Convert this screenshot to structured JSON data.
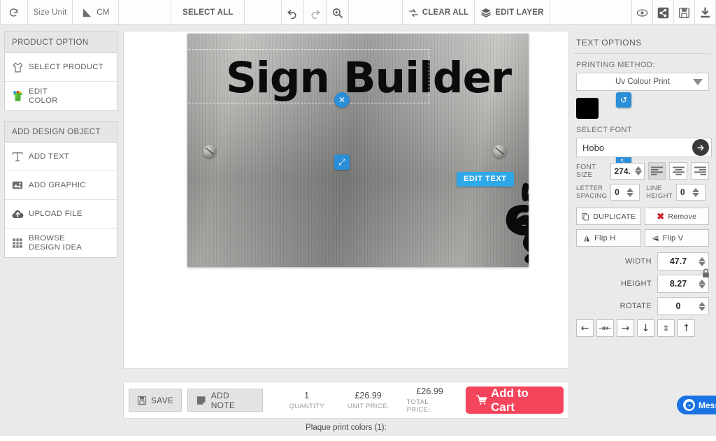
{
  "toolbar": {
    "refresh_icon": "refresh-icon",
    "size_unit_label": "Size Unit",
    "unit_value": "CM",
    "ruler_icon": "ruler-icon",
    "select_all_label": "SELECT ALL",
    "undo_icon": "undo-icon",
    "redo_icon": "redo-icon",
    "zoom_icon": "zoom-in-icon",
    "clear_all_label": "CLEAR ALL",
    "clear_all_icon": "refresh-cycle-icon",
    "edit_layer_label": "EDIT LAYER",
    "edit_layer_icon": "layers-icon",
    "preview_icon": "eye-icon",
    "share_icon": "share-icon",
    "save_icon": "floppy-save-icon",
    "download_icon": "download-icon"
  },
  "sidebar": {
    "product_option": {
      "heading": "PRODUCT OPTION",
      "items": [
        {
          "label": "SELECT PRODUCT",
          "icon": "tshirt-outline-icon"
        },
        {
          "label_line1": "EDIT",
          "label_line2": "COLOR",
          "icon": "colored-shirt-icon"
        }
      ]
    },
    "add_design_object": {
      "heading": "ADD DESIGN OBJECT",
      "items": [
        {
          "label": "ADD TEXT",
          "icon": "text-t-icon"
        },
        {
          "label": "ADD GRAPHIC",
          "icon": "image-graphic-icon"
        },
        {
          "label": "UPLOAD FILE",
          "icon": "upload-cloud-icon"
        },
        {
          "label_line1": "BROWSE",
          "label_line2": "DESIGN IDEA",
          "icon": "grid-ideas-icon"
        }
      ]
    }
  },
  "canvas": {
    "sign_text": "Sign Builder",
    "edit_text_button": "EDIT TEXT",
    "handles": {
      "close": "✕",
      "rotate": "↺",
      "scale_left": "⤢",
      "scale_right": "⤡"
    },
    "graphic_name": "ganesha-graphic"
  },
  "right_panel": {
    "title": "TEXT OPTIONS",
    "printing_method_label": "PRINTING METHOD:",
    "printing_method_value": "Uv Colour Print",
    "color_swatch": "#000000",
    "select_font_label": "SELECT FONT",
    "font_value": "Hobo",
    "font_size_label": "FONT SIZE",
    "font_size_value": "274.",
    "align_left": "align-left",
    "align_center": "align-center",
    "align_right": "align-right",
    "letter_spacing_label_1": "LETTER",
    "letter_spacing_label_2": "SPACING",
    "letter_spacing_value": "0",
    "line_height_label_1": "LINE",
    "line_height_label_2": "HEIGHT",
    "line_height_value": "0",
    "duplicate_label": "DUPLICATE",
    "remove_label": "Remove",
    "flip_h_label": "Flip H",
    "flip_v_label": "Flip V",
    "width_label": "WIDTH",
    "width_value": "47.7",
    "height_label": "HEIGHT",
    "height_value": "8.27",
    "rotate_label": "ROTATE",
    "rotate_value": "0",
    "lock_icon": "lock-icon",
    "nudge": [
      "←",
      "⇥⇤",
      "→",
      "↓",
      "⇵",
      "↑"
    ]
  },
  "bottom": {
    "save_label": "SAVE",
    "add_note_label": "ADD NOTE",
    "quantity_value": "1",
    "quantity_label": "QUANTITY",
    "unit_price_value": "£26.99",
    "unit_price_label": "UNIT PRICE:",
    "total_price_value": "£26.99",
    "total_price_label": "TOTAL PRICE:",
    "add_to_cart_label": "Add to Cart",
    "plaque_colors_label": "Plaque print colors  (1):"
  },
  "messenger": {
    "label": "Mess",
    "color": "#1b74e4"
  }
}
